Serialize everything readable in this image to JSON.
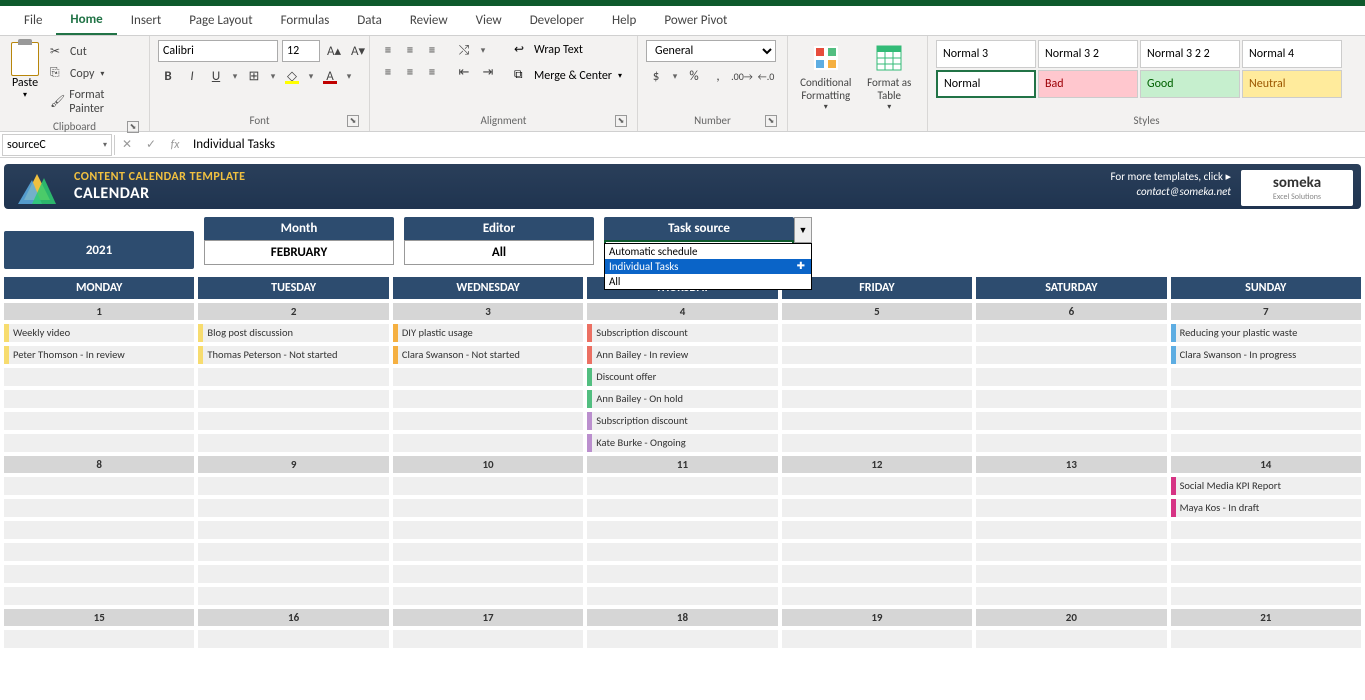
{
  "tabs": [
    "File",
    "Home",
    "Insert",
    "Page Layout",
    "Formulas",
    "Data",
    "Review",
    "View",
    "Developer",
    "Help",
    "Power Pivot"
  ],
  "activeTab": 1,
  "clipboard": {
    "paste": "Paste",
    "cut": "Cut",
    "copy": "Copy",
    "painter": "Format Painter",
    "label": "Clipboard"
  },
  "font": {
    "name": "Calibri",
    "size": "12",
    "label": "Font"
  },
  "alignment": {
    "wrap": "Wrap Text",
    "merge": "Merge & Center",
    "label": "Alignment"
  },
  "number": {
    "format": "General",
    "label": "Number"
  },
  "cond": "Conditional Formatting",
  "fmtTable": "Format as Table",
  "styles": {
    "label": "Styles",
    "cells": [
      "Normal 3",
      "Normal 3 2",
      "Normal 3 2 2",
      "Normal 4",
      "Normal",
      "Bad",
      "Good",
      "Neutral"
    ]
  },
  "namebox": "sourceC",
  "formula": "Individual Tasks",
  "banner": {
    "title1": "CONTENT CALENDAR TEMPLATE",
    "title2": "CALENDAR",
    "more": "For more templates, click ▸",
    "contact": "contact@someka.net",
    "brand": "someka",
    "brandSub": "Excel Solutions"
  },
  "year": "2021",
  "controls": {
    "month": {
      "label": "Month",
      "value": "FEBRUARY"
    },
    "editor": {
      "label": "Editor",
      "value": "All"
    },
    "source": {
      "label": "Task source",
      "value": "Individual Tasks",
      "options": [
        "Automatic schedule",
        "Individual Tasks",
        "All"
      ],
      "selectedIndex": 1
    }
  },
  "dayHeaders": [
    "MONDAY",
    "TUESDAY",
    "WEDNESDAY",
    "THURSDAY",
    "FRIDAY",
    "SATURDAY",
    "SUNDAY"
  ],
  "weeks": [
    {
      "nums": [
        "1",
        "2",
        "3",
        "4",
        "5",
        "6",
        "7"
      ],
      "tasks": [
        [
          {
            "c": "c-yellow",
            "t": "Weekly video"
          },
          {
            "c": "c-yellow",
            "t": "Peter Thomson - In review"
          }
        ],
        [
          {
            "c": "c-yellow",
            "t": "Blog post discussion"
          },
          {
            "c": "c-yellow",
            "t": "Thomas Peterson - Not started"
          }
        ],
        [
          {
            "c": "c-orange",
            "t": "DIY plastic usage"
          },
          {
            "c": "c-orange",
            "t": "Clara Swanson - Not started"
          }
        ],
        [
          {
            "c": "c-pink",
            "t": "Subscription discount"
          },
          {
            "c": "c-pink",
            "t": "Ann Bailey - In review"
          },
          {
            "c": "c-green",
            "t": "Discount offer"
          },
          {
            "c": "c-green",
            "t": "Ann Bailey - On hold"
          },
          {
            "c": "c-lav",
            "t": "Subscription discount"
          },
          {
            "c": "c-lav",
            "t": "Kate Burke - Ongoing"
          }
        ],
        [],
        [],
        [
          {
            "c": "c-blue",
            "t": "Reducing your plastic waste"
          },
          {
            "c": "c-blue",
            "t": "Clara Swanson - In progress"
          }
        ]
      ]
    },
    {
      "nums": [
        "8",
        "9",
        "10",
        "11",
        "12",
        "13",
        "14"
      ],
      "tasks": [
        [],
        [],
        [],
        [],
        [],
        [],
        [
          {
            "c": "c-mag",
            "t": "Social Media KPI Report"
          },
          {
            "c": "c-mag",
            "t": "Maya Kos - In draft"
          }
        ]
      ]
    },
    {
      "nums": [
        "15",
        "16",
        "17",
        "18",
        "19",
        "20",
        "21"
      ],
      "tasks": [
        [],
        [],
        [],
        [],
        [],
        [],
        []
      ]
    }
  ]
}
